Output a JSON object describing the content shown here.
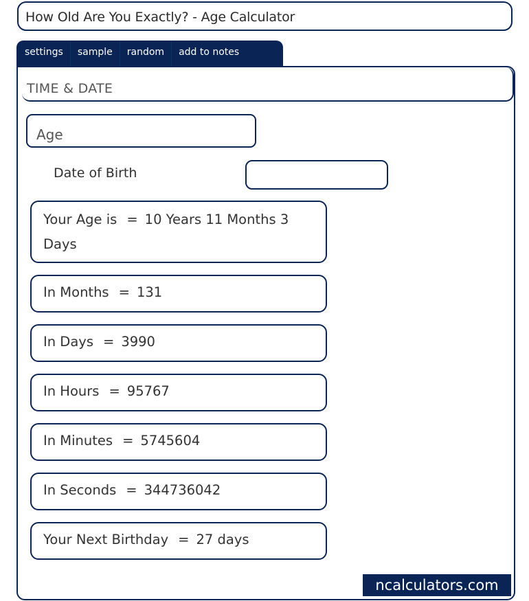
{
  "title": "How Old Are You Exactly? - Age Calculator",
  "tabs": [
    "settings",
    "sample",
    "random",
    "add to notes"
  ],
  "section_header": "TIME & DATE",
  "calculator_name": "Age",
  "inputs": {
    "date_of_birth": {
      "label": "Date of Birth",
      "value": "",
      "placeholder": ""
    }
  },
  "results": [
    {
      "label": "Your Age is",
      "value": "10 Years 11 Months 3 Days"
    },
    {
      "label": "In Months",
      "value": "131"
    },
    {
      "label": "In Days",
      "value": "3990"
    },
    {
      "label": "In Hours",
      "value": "95767"
    },
    {
      "label": "In Minutes",
      "value": "5745604"
    },
    {
      "label": "In Seconds",
      "value": "344736042"
    },
    {
      "label": "Your Next Birthday",
      "value": "27 days"
    }
  ],
  "equals_sign": "=",
  "brand": "ncalculators.com",
  "colors": {
    "accent": "#0a2456",
    "text": "#333333",
    "background": "#ffffff"
  }
}
